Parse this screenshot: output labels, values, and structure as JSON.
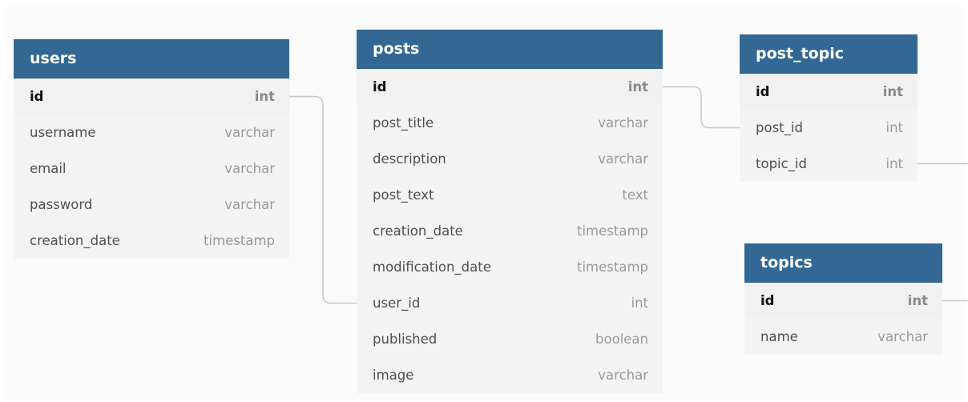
{
  "tables": {
    "users": {
      "name": "users",
      "fields": [
        {
          "name": "id",
          "type": "int"
        },
        {
          "name": "username",
          "type": "varchar"
        },
        {
          "name": "email",
          "type": "varchar"
        },
        {
          "name": "password",
          "type": "varchar"
        },
        {
          "name": "creation_date",
          "type": "timestamp"
        }
      ]
    },
    "posts": {
      "name": "posts",
      "fields": [
        {
          "name": "id",
          "type": "int"
        },
        {
          "name": "post_title",
          "type": "varchar"
        },
        {
          "name": "description",
          "type": "varchar"
        },
        {
          "name": "post_text",
          "type": "text"
        },
        {
          "name": "creation_date",
          "type": "timestamp"
        },
        {
          "name": "modification_date",
          "type": "timestamp"
        },
        {
          "name": "user_id",
          "type": "int"
        },
        {
          "name": "published",
          "type": "boolean"
        },
        {
          "name": "image",
          "type": "varchar"
        }
      ]
    },
    "post_topic": {
      "name": "post_topic",
      "fields": [
        {
          "name": "id",
          "type": "int"
        },
        {
          "name": "post_id",
          "type": "int"
        },
        {
          "name": "topic_id",
          "type": "int"
        }
      ]
    },
    "topics": {
      "name": "topics",
      "fields": [
        {
          "name": "id",
          "type": "int"
        },
        {
          "name": "name",
          "type": "varchar"
        }
      ]
    }
  },
  "relations": [
    {
      "from": "users.id",
      "to": "posts.user_id"
    },
    {
      "from": "posts.id",
      "to": "post_topic.post_id"
    },
    {
      "from": "post_topic.topic_id",
      "to": "topics.id"
    }
  ],
  "colors": {
    "header_bg": "#326893",
    "header_text": "#ffffff",
    "table_bg": "#f4f4f4",
    "connector": "#c9c9c9",
    "field_name": "#4f4f4f",
    "field_type": "#999999"
  }
}
